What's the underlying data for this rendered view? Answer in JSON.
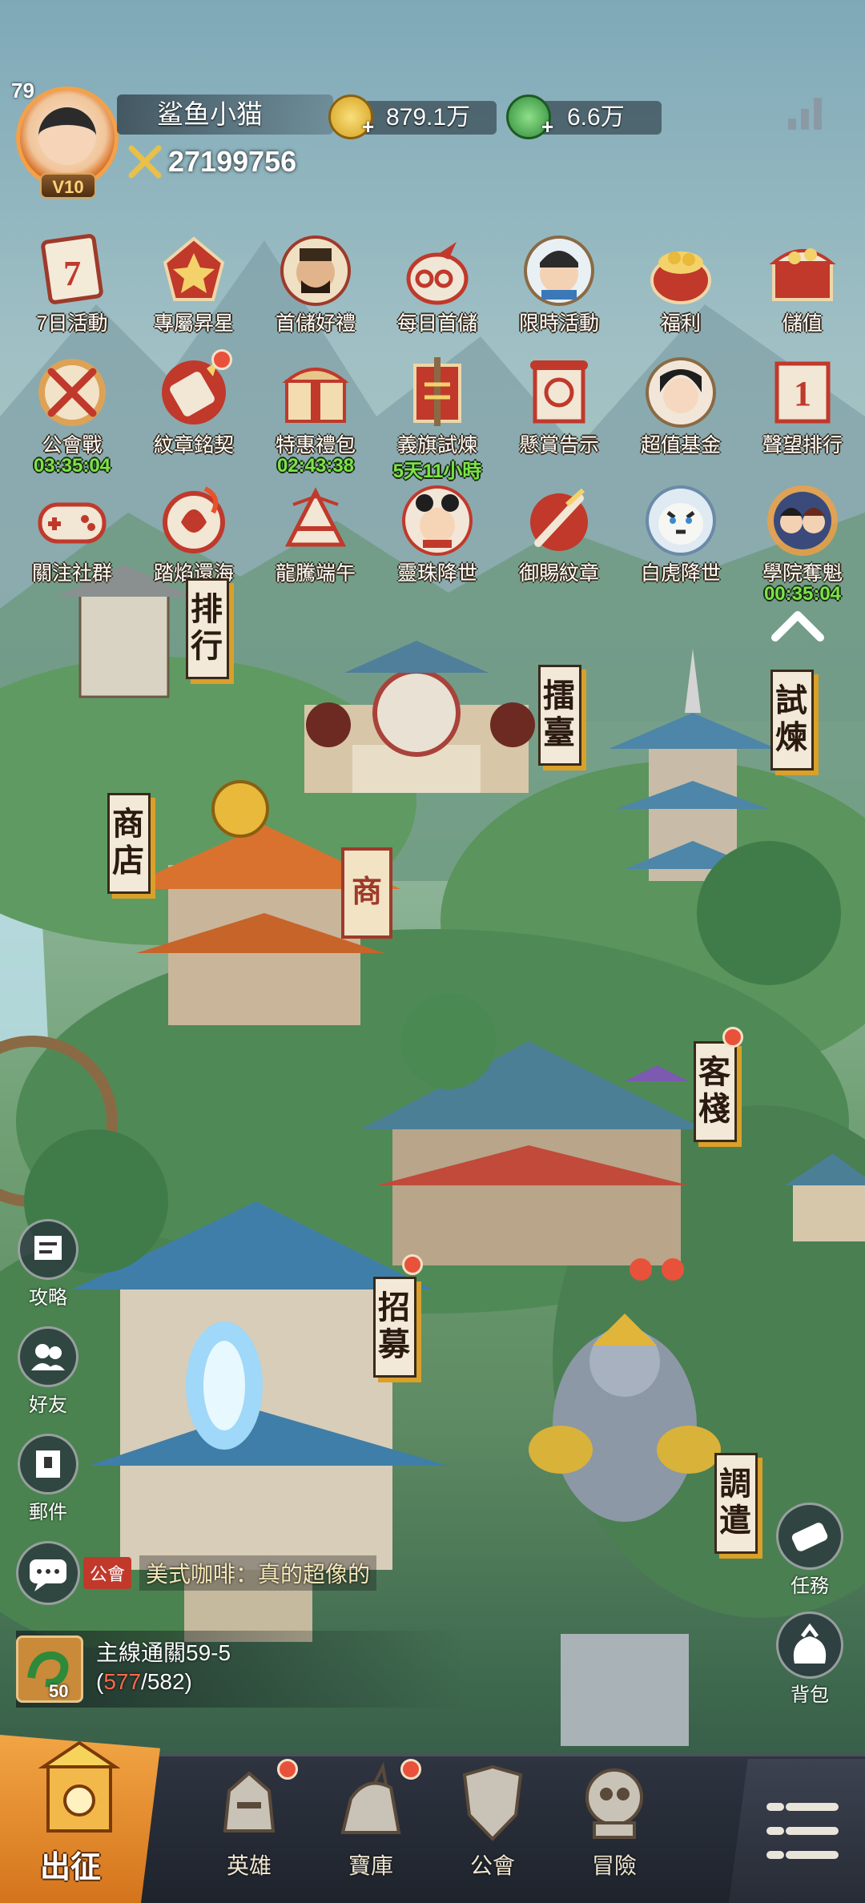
{
  "player": {
    "level": "79",
    "vip": "V10",
    "name": "鲨鱼小猫",
    "power": "27199756"
  },
  "resources": {
    "gold": "879.1万",
    "jade": "6.6万"
  },
  "events": [
    {
      "label": "7日活動",
      "icon": "calendar-seven-icon"
    },
    {
      "label": "專屬昇星",
      "icon": "star-badge-icon"
    },
    {
      "label": "首儲好禮",
      "icon": "general-portrait-icon"
    },
    {
      "label": "每日首儲",
      "icon": "gift-bag-icon"
    },
    {
      "label": "限時活動",
      "icon": "scholar-portrait-icon"
    },
    {
      "label": "福利",
      "icon": "treasure-pot-icon"
    },
    {
      "label": "儲值",
      "icon": "treasure-chest-icon"
    },
    {
      "label": "公會戰",
      "icon": "crossed-swords-icon",
      "timer": "03:35:04"
    },
    {
      "label": "紋章銘契",
      "icon": "scroll-quill-icon"
    },
    {
      "label": "特惠禮包",
      "icon": "gift-chest-icon",
      "timer": "02:43:38"
    },
    {
      "label": "義旗試煉",
      "icon": "war-banner-icon",
      "timer": "5天11小時"
    },
    {
      "label": "懸賞告示",
      "icon": "bounty-scroll-icon"
    },
    {
      "label": "超值基金",
      "icon": "lady-portrait-icon"
    },
    {
      "label": "聲望排行",
      "icon": "ranking-banner-icon"
    },
    {
      "label": "關注社群",
      "icon": "gamepad-icon"
    },
    {
      "label": "踏焰還海",
      "icon": "flame-ring-icon"
    },
    {
      "label": "龍騰端午",
      "icon": "rice-dumpling-icon"
    },
    {
      "label": "靈珠降世",
      "icon": "child-hero-icon"
    },
    {
      "label": "御賜紋章",
      "icon": "emblem-sword-icon"
    },
    {
      "label": "白虎降世",
      "icon": "white-tiger-icon"
    },
    {
      "label": "學院奪魁",
      "icon": "academy-duo-icon",
      "timer": "00:35:04"
    }
  ],
  "buildings": {
    "ranking": "排行",
    "arena": "擂臺",
    "trial": "試煉",
    "shop": "商店",
    "shop_flag": "商",
    "inn": "客棧",
    "recruit": "招募",
    "dispatch": "調遣"
  },
  "side_left": {
    "guide": "攻略",
    "friends": "好友",
    "mail": "郵件"
  },
  "side_right": {
    "tasks": "任務",
    "bag": "背包"
  },
  "chat": {
    "channel": "公會",
    "message": "美式咖啡：真的超像的"
  },
  "quest": {
    "title": "主線通關59-5",
    "level": "50",
    "current": "577",
    "total": "/582)",
    "open": "("
  },
  "nav": {
    "sortie": "出征",
    "heroes": "英雄",
    "treasury": "寶庫",
    "guild": "公會",
    "adventure": "冒險"
  },
  "colors": {
    "badge_red": "#e8523a",
    "timer_green": "#7be34a",
    "sign_gold": "#d9a02a"
  }
}
